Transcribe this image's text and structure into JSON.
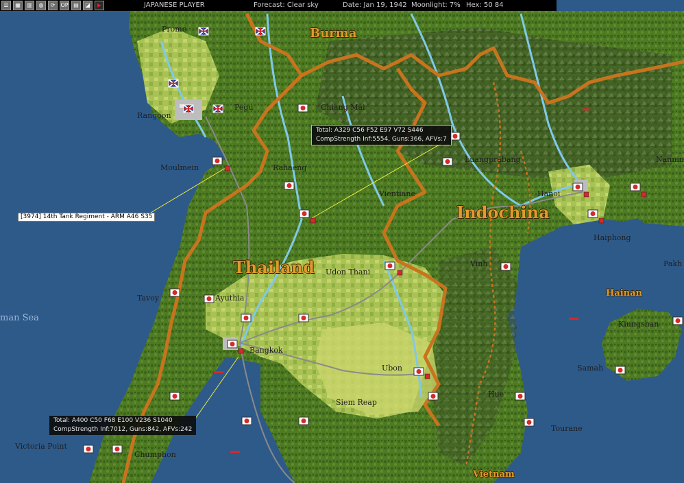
{
  "topbar": {
    "player": "JAPANESE PLAYER",
    "forecast": "Forecast: Clear sky",
    "date": "Date: Jan 19, 1942",
    "moonlight": "Moonlight: 7%",
    "hex": "Hex: 50 84",
    "icon_glyphs": [
      "☰",
      "▦",
      "▥",
      "◍",
      "⟳",
      "OP",
      "▤",
      "◪",
      "▶"
    ]
  },
  "regions": {
    "burma": "Burma",
    "thailand": "Thailand",
    "indochina": "Indochina",
    "vietnam": "Vietnam",
    "hainan": "Hainan"
  },
  "places": {
    "prome": "Prome",
    "rangoon": "Rangoon",
    "pegu": "Pegu",
    "chiang_mai": "Chiang Mai",
    "moulmein": "Moulmein",
    "rahaeng": "Rahaeng",
    "luangprabang": "Luangprabang",
    "nanning": "Nannin",
    "vientiane": "Vientiane",
    "hanoi": "Hanoi",
    "haiphong": "Haiphong",
    "udon_thani": "Udon Thani",
    "vinh": "Vinh",
    "pakhoi": "Pakh",
    "tavoy": "Tavoy",
    "ayuthia": "Ayuthia",
    "andaman_sea": "man Sea",
    "bangkok": "Bangkok",
    "kiungshan": "Kiungshan",
    "ubon": "Ubon",
    "samah": "Samah",
    "hue": "Hue",
    "siem_reap": "Siem Reap",
    "tourane": "Tourane",
    "victoria_point": "Victoria Point",
    "chumphon": "Chumphon"
  },
  "tooltips": {
    "north": {
      "line1": "Total:  A329  C56  F52  E97  V72  S446",
      "line2": "CompStrength Inf:5554, Guns:366, AFVs:7"
    },
    "south": {
      "line1": "Total:  A400  C50  F68  E100  V236  S1040",
      "line2": "CompStrength Inf:7012, Guns:842, AFVs:242"
    },
    "unit": "[3974] 14th Tank Regiment - ARM   A46 S35"
  },
  "colors": {
    "sea": "#2e5a8a",
    "jungle": "#4f7a22",
    "border": "#c8741e",
    "river": "#7fc9ea",
    "japan_marker": "#d32a2a",
    "allied_marker": "#1a2f8c"
  }
}
